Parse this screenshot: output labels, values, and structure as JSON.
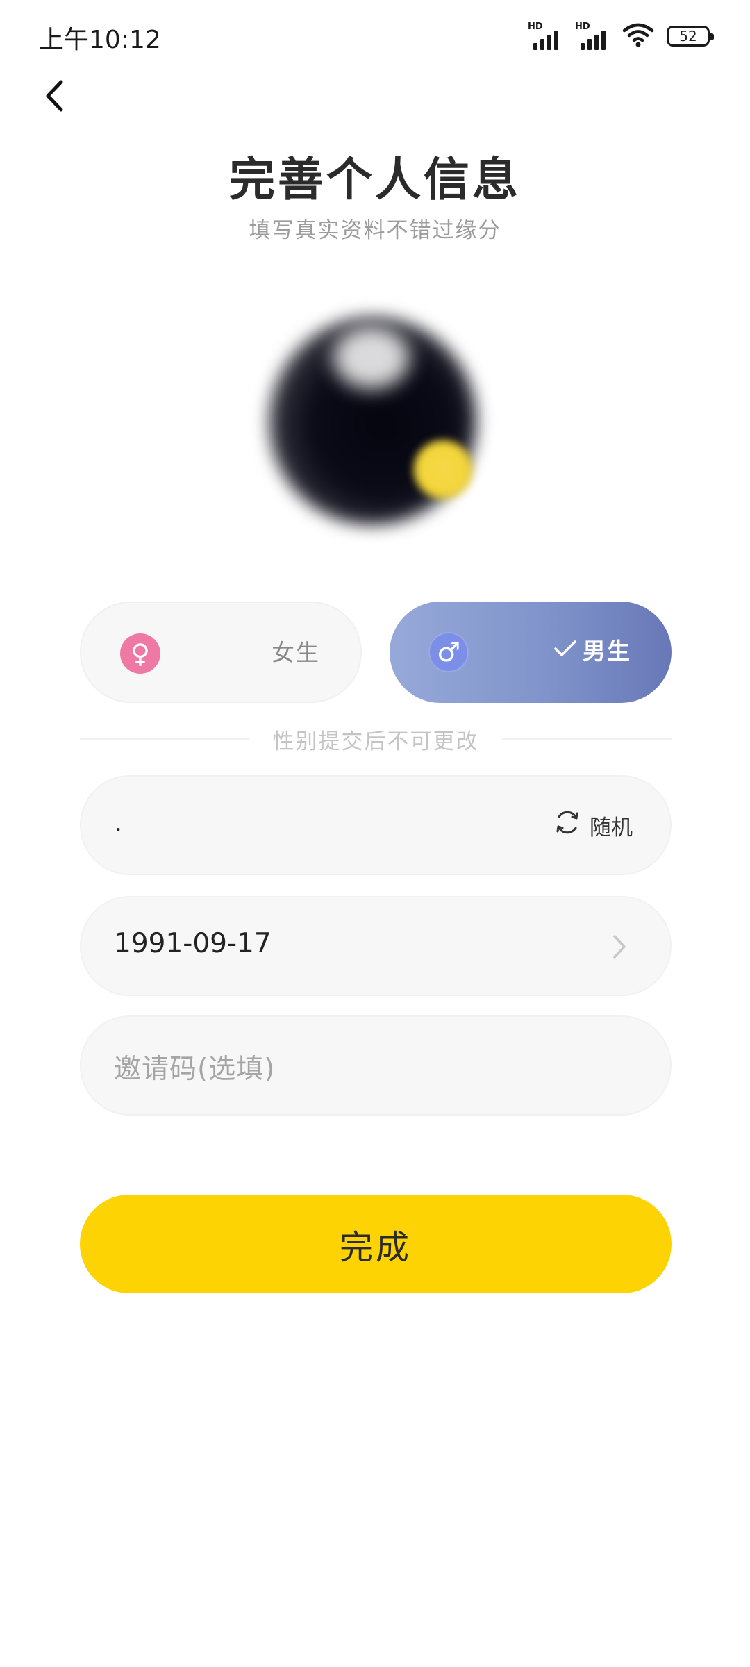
{
  "status_bar": {
    "time": "上午10:12",
    "signal_1_label": "HD",
    "signal_2_label": "HD",
    "battery": "52"
  },
  "header": {
    "back_icon": "chevron-left-icon",
    "title": "完善个人信息",
    "subtitle": "填写真实资料不错过缘分"
  },
  "gender": {
    "female_label": "女生",
    "female_icon": "♀",
    "male_label": "男生",
    "male_icon": "♂",
    "selected": "male",
    "note": "性别提交后不可更改"
  },
  "form": {
    "nickname_value": ".",
    "random_label": "随机",
    "birthday_value": "1991-09-17",
    "invite_placeholder": "邀请码(选填)"
  },
  "actions": {
    "done_label": "完成"
  },
  "colors": {
    "accent_yellow": "#fdd303",
    "male_gradient_start": "#97a9d9",
    "male_gradient_end": "#6878b7",
    "female_icon_bg": "#ef79a4"
  }
}
